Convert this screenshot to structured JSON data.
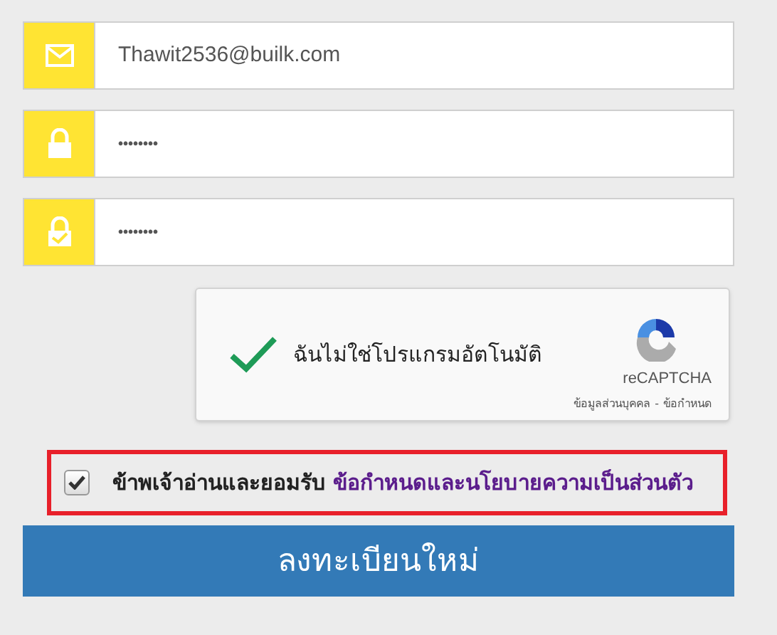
{
  "fields": [
    {
      "kind": "email",
      "value": "Thawit2536@builk.com"
    },
    {
      "kind": "password",
      "value": "••••••••"
    },
    {
      "kind": "confirm",
      "value": "••••••••"
    }
  ],
  "captcha": {
    "checked": true,
    "label": "ฉันไม่ใช่โปรแกรมอัตโนมัติ",
    "brand": "reCAPTCHA",
    "links": [
      "ข้อมูลส่วนบุคคล",
      "ข้อกำหนด"
    ],
    "separator": "-"
  },
  "agreement": {
    "checked": true,
    "text": "ข้าพเจ้าอ่านและยอมรับ",
    "link": "ข้อกำหนดและนโยบายความเป็นส่วนตัว"
  },
  "submit": {
    "label": "ลงทะเบียนใหม่"
  }
}
